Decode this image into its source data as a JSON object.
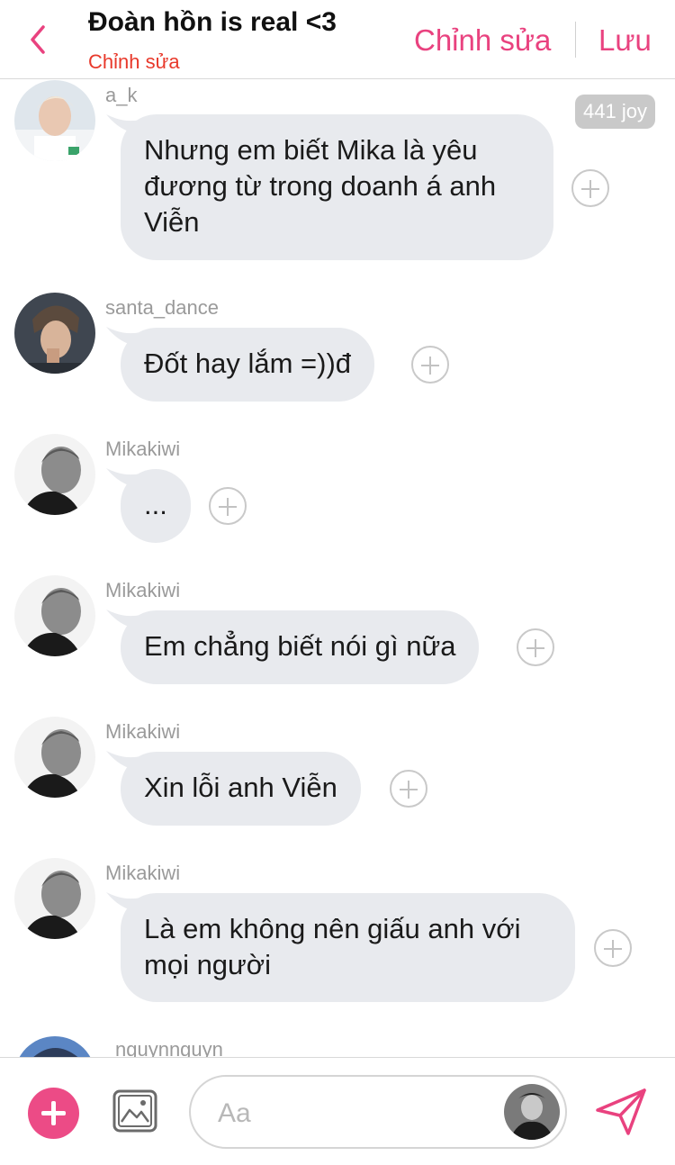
{
  "header": {
    "title": "Đoàn hồn is real <3",
    "subtitle": "Chỉnh sửa",
    "edit_label": "Chỉnh sửa",
    "save_label": "Lưu",
    "accent": "#e9427f"
  },
  "messages": [
    {
      "user": "a_k",
      "text": "Nhưng em biết Mika là yêu đương từ trong doanh á anh Viễn",
      "badge": "441 joy"
    },
    {
      "user": "santa_dance",
      "text": "Đốt hay lắm =))đ"
    },
    {
      "user": "Mikakiwi",
      "text": "..."
    },
    {
      "user": "Mikakiwi",
      "text": "Em chẳng biết nói gì nữa"
    },
    {
      "user": "Mikakiwi",
      "text": "Xin lỗi anh Viễn"
    },
    {
      "user": "Mikakiwi",
      "text": "Là em không nên giấu anh với mọi người"
    },
    {
      "user": "nguynnguyn"
    }
  ],
  "composer": {
    "placeholder": "Aa"
  }
}
